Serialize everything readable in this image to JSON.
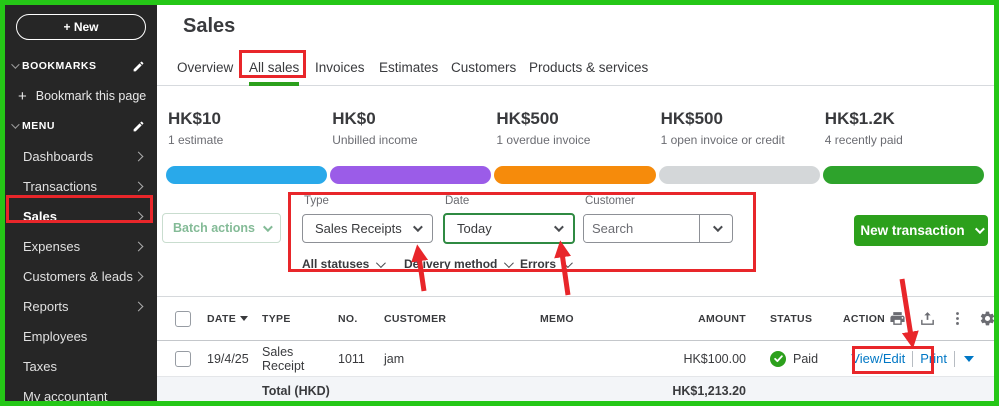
{
  "app": {
    "title": "Sales"
  },
  "sidebar": {
    "new_button_label": "+ New",
    "bookmarks_header": "BOOKMARKS",
    "bookmark_plus": "+",
    "bookmark_this_label": "Bookmark this page",
    "menu_header": "MENU",
    "items": [
      {
        "label": "Dashboards",
        "expandable": true,
        "active": false
      },
      {
        "label": "Transactions",
        "expandable": true,
        "active": false
      },
      {
        "label": "Sales",
        "expandable": true,
        "active": true
      },
      {
        "label": "Expenses",
        "expandable": true,
        "active": false
      },
      {
        "label": "Customers & leads",
        "expandable": true,
        "active": false
      },
      {
        "label": "Reports",
        "expandable": true,
        "active": false
      },
      {
        "label": "Employees",
        "expandable": false,
        "active": false
      },
      {
        "label": "Taxes",
        "expandable": false,
        "active": false
      },
      {
        "label": "My accountant",
        "expandable": false,
        "active": false
      }
    ]
  },
  "tabs": [
    {
      "label": "Overview",
      "active": false
    },
    {
      "label": "All sales",
      "active": true
    },
    {
      "label": "Invoices",
      "active": false
    },
    {
      "label": "Estimates",
      "active": false
    },
    {
      "label": "Customers",
      "active": false
    },
    {
      "label": "Products & services",
      "active": false
    }
  ],
  "money_bar": {
    "cards": [
      {
        "amount": "HK$10",
        "label": "1 estimate",
        "color": "#29A9EA"
      },
      {
        "amount": "HK$0",
        "label": "Unbilled income",
        "color": "#9B5CE8"
      },
      {
        "amount": "HK$500",
        "label": "1 overdue invoice",
        "color": "#F68B0B"
      },
      {
        "amount": "HK$500",
        "label": "1 open invoice or credit",
        "color": "#D4D7D9"
      },
      {
        "amount": "HK$1.2K",
        "label": "4 recently paid",
        "color": "#2EA32C"
      }
    ]
  },
  "filters": {
    "batch_actions_label": "Batch actions",
    "type": {
      "label": "Type",
      "value": "Sales Receipts"
    },
    "date": {
      "label": "Date",
      "value": "Today"
    },
    "customer": {
      "label": "Customer",
      "placeholder": "Search"
    },
    "secondary": [
      {
        "label": "All statuses"
      },
      {
        "label": "Delivery method"
      },
      {
        "label": "Errors"
      }
    ],
    "new_transaction_label": "New transaction"
  },
  "table": {
    "headers": {
      "date": "DATE",
      "type": "TYPE",
      "no": "NO.",
      "customer": "CUSTOMER",
      "memo": "MEMO",
      "amount": "AMOUNT",
      "status": "STATUS",
      "action": "ACTION"
    },
    "rows": [
      {
        "date": "19/4/25",
        "type": "Sales Receipt",
        "no": "1011",
        "customer": "jam",
        "memo": "",
        "amount": "HK$100.00",
        "status": "Paid",
        "action_primary": "View/Edit",
        "action_secondary": "Print"
      }
    ],
    "total_label": "Total (HKD)",
    "total_amount": "HK$1,213.20"
  },
  "colors": {
    "accent_green": "#2CA01C",
    "link_blue": "#0077C5",
    "annotation_red": "#E8262A",
    "frame_green": "#25C717",
    "sidebar_bg": "#262626"
  }
}
